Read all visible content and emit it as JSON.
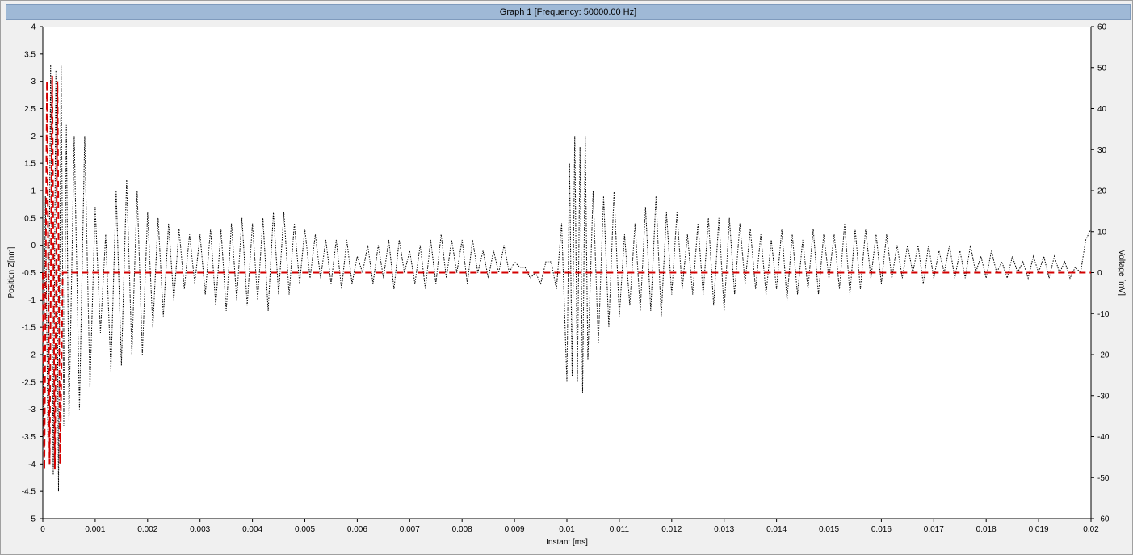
{
  "window": {
    "title": "Graph 1 [Frequency: 50000.00 Hz]"
  },
  "chart_data": {
    "type": "line",
    "title": "Graph 1 [Frequency: 50000.00 Hz]",
    "xlabel": "Instant [ms]",
    "ylabel": "Position Z[nm]",
    "y2label": "Voltage [mV]",
    "xlim": [
      0,
      0.02
    ],
    "ylim": [
      -5,
      4
    ],
    "y2lim": [
      -60,
      60
    ],
    "grid": false,
    "x_ticks": [
      "0",
      "0.001",
      "0.002",
      "0.003",
      "0.004",
      "0.005",
      "0.006",
      "0.007",
      "0.008",
      "0.009",
      "0.01",
      "0.011",
      "0.012",
      "0.013",
      "0.014",
      "0.015",
      "0.016",
      "0.017",
      "0.018",
      "0.019",
      "0.02"
    ],
    "y_ticks": [
      "4",
      "3.5",
      "3",
      "2.5",
      "2",
      "1.5",
      "1",
      "0.5",
      "0",
      "-0.5",
      "-1",
      "-1.5",
      "-2",
      "-2.5",
      "-3",
      "-3.5",
      "-4",
      "-4.5",
      "-5"
    ],
    "y2_ticks": [
      "60",
      "50",
      "40",
      "30",
      "20",
      "10",
      "0",
      "-10",
      "-20",
      "-30",
      "-40",
      "-50",
      "-60"
    ],
    "series": [
      {
        "axis": "left",
        "color": "#000000",
        "style": "dotted",
        "points": [
          [
            0.0,
            -3.8
          ],
          [
            5e-05,
            0.9
          ],
          [
            0.0001,
            -3.7
          ],
          [
            0.00015,
            3.3
          ],
          [
            0.0002,
            -4.2
          ],
          [
            0.00025,
            3.2
          ],
          [
            0.0003,
            -4.5
          ],
          [
            0.00035,
            3.3
          ],
          [
            0.0004,
            -3.3
          ],
          [
            0.00045,
            2.2
          ],
          [
            0.0005,
            -3.2
          ],
          [
            0.0006,
            2.0
          ],
          [
            0.0007,
            -3.0
          ],
          [
            0.0008,
            2.0
          ],
          [
            0.0009,
            -2.6
          ],
          [
            0.001,
            0.7
          ],
          [
            0.0011,
            -1.6
          ],
          [
            0.0012,
            0.2
          ],
          [
            0.0013,
            -2.3
          ],
          [
            0.0014,
            1.0
          ],
          [
            0.0015,
            -2.2
          ],
          [
            0.0016,
            1.2
          ],
          [
            0.0017,
            -2.0
          ],
          [
            0.0018,
            1.0
          ],
          [
            0.0019,
            -2.0
          ],
          [
            0.002,
            0.6
          ],
          [
            0.0021,
            -1.5
          ],
          [
            0.0022,
            0.5
          ],
          [
            0.0023,
            -1.3
          ],
          [
            0.0024,
            0.4
          ],
          [
            0.0025,
            -1.0
          ],
          [
            0.0026,
            0.3
          ],
          [
            0.0027,
            -0.8
          ],
          [
            0.0028,
            0.2
          ],
          [
            0.0029,
            -0.7
          ],
          [
            0.003,
            0.2
          ],
          [
            0.0031,
            -0.9
          ],
          [
            0.0032,
            0.3
          ],
          [
            0.0033,
            -1.1
          ],
          [
            0.0034,
            0.3
          ],
          [
            0.0035,
            -1.2
          ],
          [
            0.0036,
            0.4
          ],
          [
            0.0037,
            -1.0
          ],
          [
            0.0038,
            0.5
          ],
          [
            0.0039,
            -1.1
          ],
          [
            0.004,
            0.4
          ],
          [
            0.0041,
            -1.0
          ],
          [
            0.0042,
            0.5
          ],
          [
            0.0043,
            -1.2
          ],
          [
            0.0044,
            0.6
          ],
          [
            0.0045,
            -0.9
          ],
          [
            0.0046,
            0.6
          ],
          [
            0.0047,
            -0.9
          ],
          [
            0.0048,
            0.4
          ],
          [
            0.0049,
            -0.7
          ],
          [
            0.005,
            0.3
          ],
          [
            0.0051,
            -0.6
          ],
          [
            0.0052,
            0.2
          ],
          [
            0.0053,
            -0.6
          ],
          [
            0.0054,
            0.1
          ],
          [
            0.0055,
            -0.7
          ],
          [
            0.0056,
            0.1
          ],
          [
            0.0057,
            -0.8
          ],
          [
            0.0058,
            0.1
          ],
          [
            0.0059,
            -0.7
          ],
          [
            0.006,
            -0.2
          ],
          [
            0.0061,
            -0.5
          ],
          [
            0.0062,
            0.0
          ],
          [
            0.0063,
            -0.7
          ],
          [
            0.0064,
            0.0
          ],
          [
            0.0065,
            -0.6
          ],
          [
            0.0066,
            0.1
          ],
          [
            0.0067,
            -0.8
          ],
          [
            0.0068,
            0.1
          ],
          [
            0.0069,
            -0.5
          ],
          [
            0.007,
            -0.1
          ],
          [
            0.0071,
            -0.7
          ],
          [
            0.0072,
            0.0
          ],
          [
            0.0073,
            -0.8
          ],
          [
            0.0074,
            0.1
          ],
          [
            0.0075,
            -0.7
          ],
          [
            0.0076,
            0.2
          ],
          [
            0.0077,
            -0.6
          ],
          [
            0.0078,
            0.1
          ],
          [
            0.0079,
            -0.5
          ],
          [
            0.008,
            0.1
          ],
          [
            0.0081,
            -0.7
          ],
          [
            0.0082,
            0.1
          ],
          [
            0.0083,
            -0.5
          ],
          [
            0.0084,
            -0.1
          ],
          [
            0.0085,
            -0.6
          ],
          [
            0.0086,
            -0.1
          ],
          [
            0.0087,
            -0.5
          ],
          [
            0.0088,
            0.0
          ],
          [
            0.0089,
            -0.5
          ],
          [
            0.009,
            -0.3
          ],
          [
            0.0091,
            -0.4
          ],
          [
            0.0092,
            -0.4
          ],
          [
            0.0093,
            -0.6
          ],
          [
            0.0094,
            -0.5
          ],
          [
            0.0095,
            -0.7
          ],
          [
            0.0096,
            -0.3
          ],
          [
            0.0097,
            -0.3
          ],
          [
            0.0098,
            -0.8
          ],
          [
            0.0099,
            0.4
          ],
          [
            0.01,
            -2.5
          ],
          [
            0.01005,
            1.5
          ],
          [
            0.0101,
            -2.4
          ],
          [
            0.01015,
            2.0
          ],
          [
            0.0102,
            -2.5
          ],
          [
            0.01025,
            1.8
          ],
          [
            0.0103,
            -2.7
          ],
          [
            0.01035,
            2.0
          ],
          [
            0.0104,
            -2.1
          ],
          [
            0.0105,
            1.0
          ],
          [
            0.0106,
            -1.8
          ],
          [
            0.0107,
            0.9
          ],
          [
            0.0108,
            -1.5
          ],
          [
            0.0109,
            1.0
          ],
          [
            0.011,
            -1.3
          ],
          [
            0.0111,
            0.2
          ],
          [
            0.0112,
            -1.1
          ],
          [
            0.0113,
            0.4
          ],
          [
            0.0114,
            -1.2
          ],
          [
            0.0115,
            0.7
          ],
          [
            0.0116,
            -1.2
          ],
          [
            0.0117,
            0.9
          ],
          [
            0.0118,
            -1.3
          ],
          [
            0.0119,
            0.6
          ],
          [
            0.012,
            -0.9
          ],
          [
            0.0121,
            0.6
          ],
          [
            0.0122,
            -0.8
          ],
          [
            0.0123,
            0.2
          ],
          [
            0.0124,
            -0.9
          ],
          [
            0.0125,
            0.4
          ],
          [
            0.0126,
            -0.9
          ],
          [
            0.0127,
            0.5
          ],
          [
            0.0128,
            -1.1
          ],
          [
            0.0129,
            0.5
          ],
          [
            0.013,
            -1.2
          ],
          [
            0.0131,
            0.5
          ],
          [
            0.0132,
            -0.9
          ],
          [
            0.0133,
            0.4
          ],
          [
            0.0134,
            -0.7
          ],
          [
            0.0135,
            0.3
          ],
          [
            0.0136,
            -0.8
          ],
          [
            0.0137,
            0.2
          ],
          [
            0.0138,
            -0.9
          ],
          [
            0.0139,
            0.1
          ],
          [
            0.014,
            -0.8
          ],
          [
            0.0141,
            0.3
          ],
          [
            0.0142,
            -1.0
          ],
          [
            0.0143,
            0.2
          ],
          [
            0.0144,
            -0.9
          ],
          [
            0.0145,
            0.1
          ],
          [
            0.0146,
            -0.8
          ],
          [
            0.0147,
            0.3
          ],
          [
            0.0148,
            -0.9
          ],
          [
            0.0149,
            0.2
          ],
          [
            0.015,
            -0.6
          ],
          [
            0.0151,
            0.2
          ],
          [
            0.0152,
            -0.8
          ],
          [
            0.0153,
            0.4
          ],
          [
            0.0154,
            -0.9
          ],
          [
            0.0155,
            0.3
          ],
          [
            0.0156,
            -0.8
          ],
          [
            0.0157,
            0.3
          ],
          [
            0.0158,
            -0.6
          ],
          [
            0.0159,
            0.2
          ],
          [
            0.016,
            -0.7
          ],
          [
            0.0161,
            0.2
          ],
          [
            0.0162,
            -0.6
          ],
          [
            0.0163,
            0.0
          ],
          [
            0.0164,
            -0.6
          ],
          [
            0.0165,
            0.0
          ],
          [
            0.0166,
            -0.5
          ],
          [
            0.0167,
            0.0
          ],
          [
            0.0168,
            -0.7
          ],
          [
            0.0169,
            0.0
          ],
          [
            0.017,
            -0.6
          ],
          [
            0.0171,
            -0.1
          ],
          [
            0.0172,
            -0.5
          ],
          [
            0.0173,
            0.0
          ],
          [
            0.0174,
            -0.6
          ],
          [
            0.0175,
            -0.1
          ],
          [
            0.0176,
            -0.6
          ],
          [
            0.0177,
            0.0
          ],
          [
            0.0178,
            -0.5
          ],
          [
            0.0179,
            -0.2
          ],
          [
            0.018,
            -0.6
          ],
          [
            0.0181,
            -0.1
          ],
          [
            0.0182,
            -0.5
          ],
          [
            0.0183,
            -0.3
          ],
          [
            0.0184,
            -0.6
          ],
          [
            0.0185,
            -0.2
          ],
          [
            0.0186,
            -0.5
          ],
          [
            0.0187,
            -0.3
          ],
          [
            0.0188,
            -0.6
          ],
          [
            0.0189,
            -0.2
          ],
          [
            0.019,
            -0.5
          ],
          [
            0.0191,
            -0.2
          ],
          [
            0.0192,
            -0.6
          ],
          [
            0.0193,
            -0.2
          ],
          [
            0.0194,
            -0.5
          ],
          [
            0.0195,
            -0.3
          ],
          [
            0.0196,
            -0.6
          ],
          [
            0.0197,
            -0.4
          ],
          [
            0.0198,
            -0.5
          ],
          [
            0.0199,
            0.1
          ],
          [
            0.02,
            0.3
          ]
        ]
      },
      {
        "axis": "left",
        "color": "#d40000",
        "style": "dashed",
        "points": [
          [
            0.0,
            -0.5
          ],
          [
            3e-05,
            -4.1
          ],
          [
            8e-05,
            3.0
          ],
          [
            0.00013,
            -4.0
          ],
          [
            0.00018,
            3.1
          ],
          [
            0.00023,
            -4.1
          ],
          [
            0.00028,
            3.0
          ],
          [
            0.00033,
            -4.0
          ],
          [
            0.00038,
            -0.5
          ],
          [
            0.0005,
            -0.5
          ],
          [
            0.0007,
            -0.5
          ],
          [
            0.001,
            -0.5
          ],
          [
            0.005,
            -0.5
          ],
          [
            0.01,
            -0.5
          ],
          [
            0.015,
            -0.5
          ],
          [
            0.02,
            -0.5
          ]
        ]
      }
    ]
  }
}
